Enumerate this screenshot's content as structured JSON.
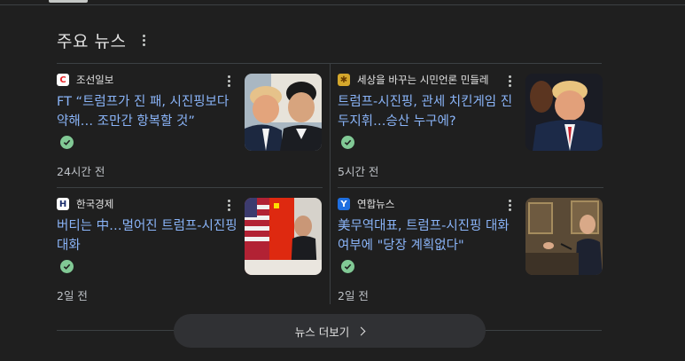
{
  "section": {
    "title": "주요 뉴스"
  },
  "articles": [
    {
      "source": "조선일보",
      "headline": "FT “트럼프가 진 패, 시진핑보다 약해… 조만간 항복할 것”",
      "time": "24시간 전",
      "logo_glyph": "C",
      "logo_bg": "#ffffff",
      "logo_color": "#e8262a"
    },
    {
      "source": "세상을 바꾸는 시민언론 민들레",
      "headline": "트럼프-시진핑, 관세 치킨게임 진두지휘…승산 누구에?",
      "time": "5시간 전",
      "logo_glyph": "✱",
      "logo_bg": "#d4a72c",
      "logo_color": "#6b3e00"
    },
    {
      "source": "한국경제",
      "headline": "버티는 中…멀어진 트럼프-시진핑 대화",
      "time": "2일 전",
      "logo_glyph": "H",
      "logo_bg": "#ffffff",
      "logo_color": "#1a2d6b"
    },
    {
      "source": "연합뉴스",
      "headline": "美무역대표, 트럼프-시진핑 대화 여부에 \"당장 계획없다\"",
      "time": "2일 전",
      "logo_glyph": "Y",
      "logo_bg": "#1f6fe0",
      "logo_color": "#ffffff"
    }
  ],
  "more_button": {
    "label": "뉴스 더보기"
  },
  "colors": {
    "background": "#1f1f1f",
    "link": "#8ab4f8",
    "verified": "#81c995",
    "button_bg": "#303134",
    "divider": "#3c4043"
  }
}
